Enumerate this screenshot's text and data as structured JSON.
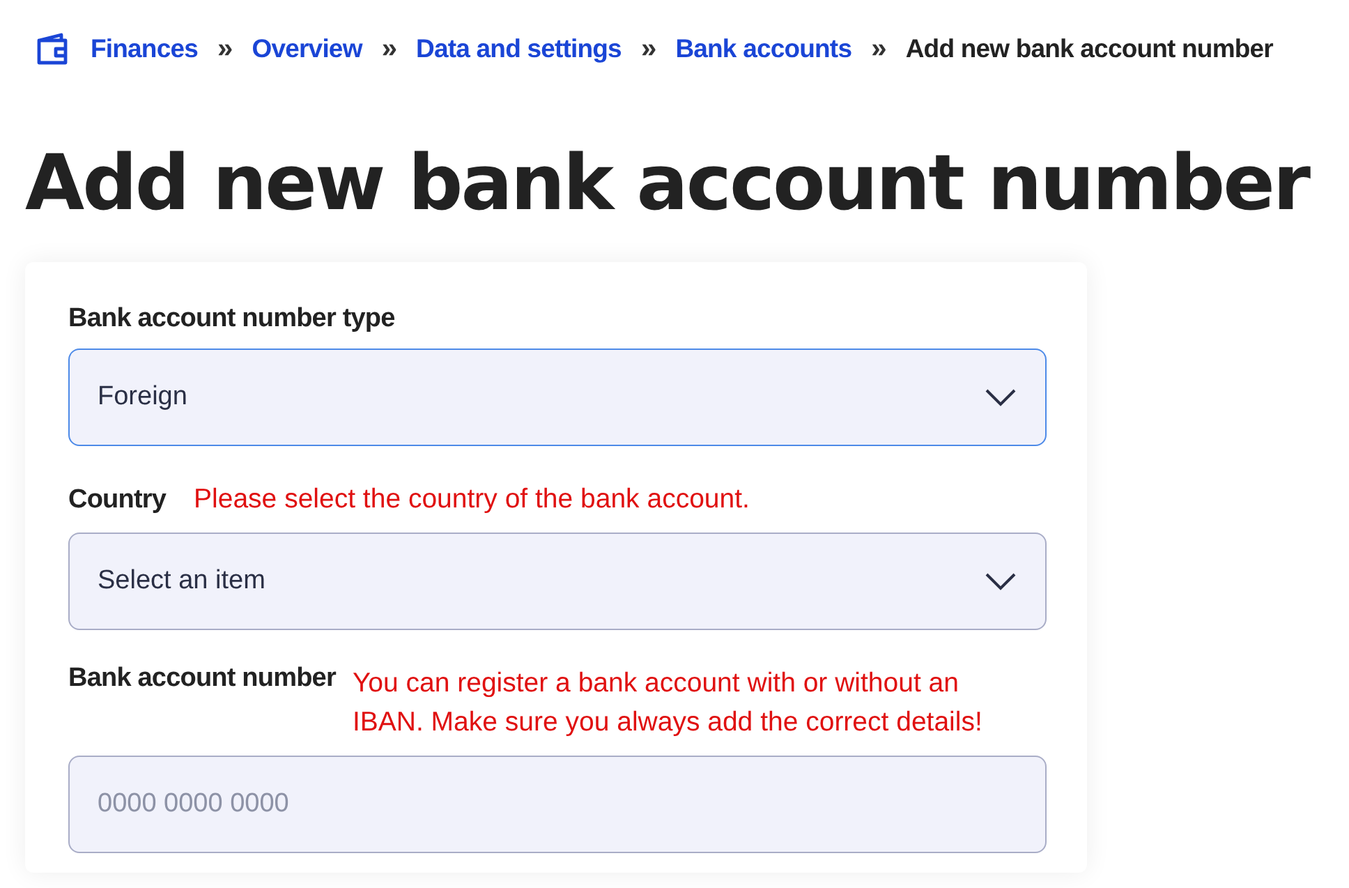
{
  "breadcrumb": {
    "separator": "»",
    "items": [
      {
        "label": "Finances",
        "current": false
      },
      {
        "label": "Overview",
        "current": false
      },
      {
        "label": "Data and settings",
        "current": false
      },
      {
        "label": "Bank accounts",
        "current": false
      },
      {
        "label": "Add new bank account number",
        "current": true
      }
    ]
  },
  "title": "Add new bank account number",
  "form": {
    "fields": [
      {
        "kind": "select",
        "label": "Bank account number type",
        "value": "Foreign",
        "focused": true
      },
      {
        "kind": "select",
        "label": "Country",
        "note": "Please select the country of the bank account.",
        "placeholder": "Select an item",
        "focused": false
      },
      {
        "kind": "text",
        "label": "Bank account number",
        "note": "You can register a bank account with or without an IBAN. Make sure you always add the correct details!",
        "placeholder": "0000 0000 0000",
        "focused": false
      }
    ]
  }
}
